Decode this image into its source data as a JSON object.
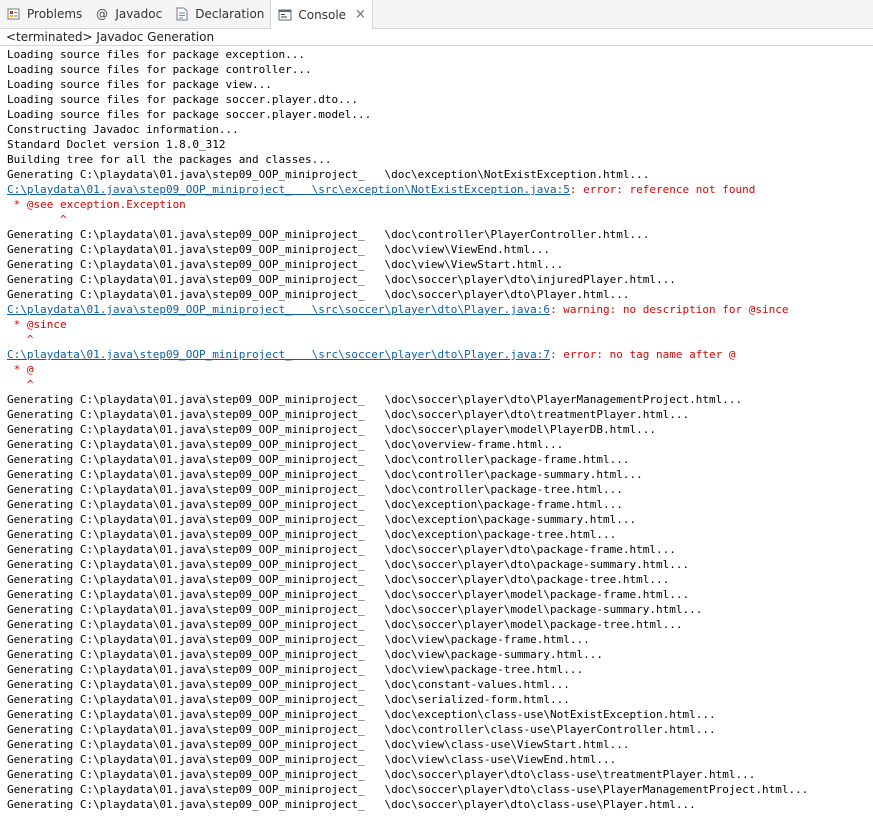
{
  "tabs": [
    {
      "label": "Problems",
      "icon": "problems-icon"
    },
    {
      "label": "Javadoc",
      "icon": "javadoc-icon"
    },
    {
      "label": "Declaration",
      "icon": "declaration-icon"
    },
    {
      "label": "Console",
      "icon": "console-icon",
      "active": true,
      "close": "×"
    }
  ],
  "status": "<terminated> Javadoc Generation",
  "colors": {
    "error": "#e00000",
    "link": "#0f5ea8"
  },
  "lines": [
    {
      "t": "Loading source files for package exception..."
    },
    {
      "t": "Loading source files for package controller..."
    },
    {
      "t": "Loading source files for package view..."
    },
    {
      "t": "Loading source files for package soccer.player.dto..."
    },
    {
      "t": "Loading source files for package soccer.player.model..."
    },
    {
      "t": "Constructing Javadoc information..."
    },
    {
      "t": "Standard Doclet version 1.8.0_312"
    },
    {
      "t": "Building tree for all the packages and classes..."
    },
    {
      "t": "Generating C:\\playdata\\01.java\\step09_OOP_miniproject_   \\doc\\exception\\NotExistException.html..."
    },
    {
      "link": "C:\\playdata\\01.java\\step09_OOP_miniproject_   \\src\\exception\\NotExistException.java:5",
      "msg": ": error: reference not found"
    },
    {
      "err": " * @see exception.Exception"
    },
    {
      "err": "        ^"
    },
    {
      "t": "Generating C:\\playdata\\01.java\\step09_OOP_miniproject_   \\doc\\controller\\PlayerController.html..."
    },
    {
      "t": "Generating C:\\playdata\\01.java\\step09_OOP_miniproject_   \\doc\\view\\ViewEnd.html..."
    },
    {
      "t": "Generating C:\\playdata\\01.java\\step09_OOP_miniproject_   \\doc\\view\\ViewStart.html..."
    },
    {
      "t": "Generating C:\\playdata\\01.java\\step09_OOP_miniproject_   \\doc\\soccer\\player\\dto\\injuredPlayer.html..."
    },
    {
      "t": "Generating C:\\playdata\\01.java\\step09_OOP_miniproject_   \\doc\\soccer\\player\\dto\\Player.html..."
    },
    {
      "link": "C:\\playdata\\01.java\\step09_OOP_miniproject_   \\src\\soccer\\player\\dto\\Player.java:6",
      "msg": ": warning: no description for @since"
    },
    {
      "err": " * @since"
    },
    {
      "err": "   ^"
    },
    {
      "link": "C:\\playdata\\01.java\\step09_OOP_miniproject_   \\src\\soccer\\player\\dto\\Player.java:7",
      "msg": ": error: no tag name after @"
    },
    {
      "err": " * @"
    },
    {
      "err": "   ^"
    },
    {
      "t": "Generating C:\\playdata\\01.java\\step09_OOP_miniproject_   \\doc\\soccer\\player\\dto\\PlayerManagementProject.html..."
    },
    {
      "t": "Generating C:\\playdata\\01.java\\step09_OOP_miniproject_   \\doc\\soccer\\player\\dto\\treatmentPlayer.html..."
    },
    {
      "t": "Generating C:\\playdata\\01.java\\step09_OOP_miniproject_   \\doc\\soccer\\player\\model\\PlayerDB.html..."
    },
    {
      "t": "Generating C:\\playdata\\01.java\\step09_OOP_miniproject_   \\doc\\overview-frame.html..."
    },
    {
      "t": "Generating C:\\playdata\\01.java\\step09_OOP_miniproject_   \\doc\\controller\\package-frame.html..."
    },
    {
      "t": "Generating C:\\playdata\\01.java\\step09_OOP_miniproject_   \\doc\\controller\\package-summary.html..."
    },
    {
      "t": "Generating C:\\playdata\\01.java\\step09_OOP_miniproject_   \\doc\\controller\\package-tree.html..."
    },
    {
      "t": "Generating C:\\playdata\\01.java\\step09_OOP_miniproject_   \\doc\\exception\\package-frame.html..."
    },
    {
      "t": "Generating C:\\playdata\\01.java\\step09_OOP_miniproject_   \\doc\\exception\\package-summary.html..."
    },
    {
      "t": "Generating C:\\playdata\\01.java\\step09_OOP_miniproject_   \\doc\\exception\\package-tree.html..."
    },
    {
      "t": "Generating C:\\playdata\\01.java\\step09_OOP_miniproject_   \\doc\\soccer\\player\\dto\\package-frame.html..."
    },
    {
      "t": "Generating C:\\playdata\\01.java\\step09_OOP_miniproject_   \\doc\\soccer\\player\\dto\\package-summary.html..."
    },
    {
      "t": "Generating C:\\playdata\\01.java\\step09_OOP_miniproject_   \\doc\\soccer\\player\\dto\\package-tree.html..."
    },
    {
      "t": "Generating C:\\playdata\\01.java\\step09_OOP_miniproject_   \\doc\\soccer\\player\\model\\package-frame.html..."
    },
    {
      "t": "Generating C:\\playdata\\01.java\\step09_OOP_miniproject_   \\doc\\soccer\\player\\model\\package-summary.html..."
    },
    {
      "t": "Generating C:\\playdata\\01.java\\step09_OOP_miniproject_   \\doc\\soccer\\player\\model\\package-tree.html..."
    },
    {
      "t": "Generating C:\\playdata\\01.java\\step09_OOP_miniproject_   \\doc\\view\\package-frame.html..."
    },
    {
      "t": "Generating C:\\playdata\\01.java\\step09_OOP_miniproject_   \\doc\\view\\package-summary.html..."
    },
    {
      "t": "Generating C:\\playdata\\01.java\\step09_OOP_miniproject_   \\doc\\view\\package-tree.html..."
    },
    {
      "t": "Generating C:\\playdata\\01.java\\step09_OOP_miniproject_   \\doc\\constant-values.html..."
    },
    {
      "t": "Generating C:\\playdata\\01.java\\step09_OOP_miniproject_   \\doc\\serialized-form.html..."
    },
    {
      "t": "Generating C:\\playdata\\01.java\\step09_OOP_miniproject_   \\doc\\exception\\class-use\\NotExistException.html..."
    },
    {
      "t": "Generating C:\\playdata\\01.java\\step09_OOP_miniproject_   \\doc\\controller\\class-use\\PlayerController.html..."
    },
    {
      "t": "Generating C:\\playdata\\01.java\\step09_OOP_miniproject_   \\doc\\view\\class-use\\ViewStart.html..."
    },
    {
      "t": "Generating C:\\playdata\\01.java\\step09_OOP_miniproject_   \\doc\\view\\class-use\\ViewEnd.html..."
    },
    {
      "t": "Generating C:\\playdata\\01.java\\step09_OOP_miniproject_   \\doc\\soccer\\player\\dto\\class-use\\treatmentPlayer.html..."
    },
    {
      "t": "Generating C:\\playdata\\01.java\\step09_OOP_miniproject_   \\doc\\soccer\\player\\dto\\class-use\\PlayerManagementProject.html..."
    },
    {
      "t": "Generating C:\\playdata\\01.java\\step09_OOP_miniproject_   \\doc\\soccer\\player\\dto\\class-use\\Player.html..."
    }
  ]
}
